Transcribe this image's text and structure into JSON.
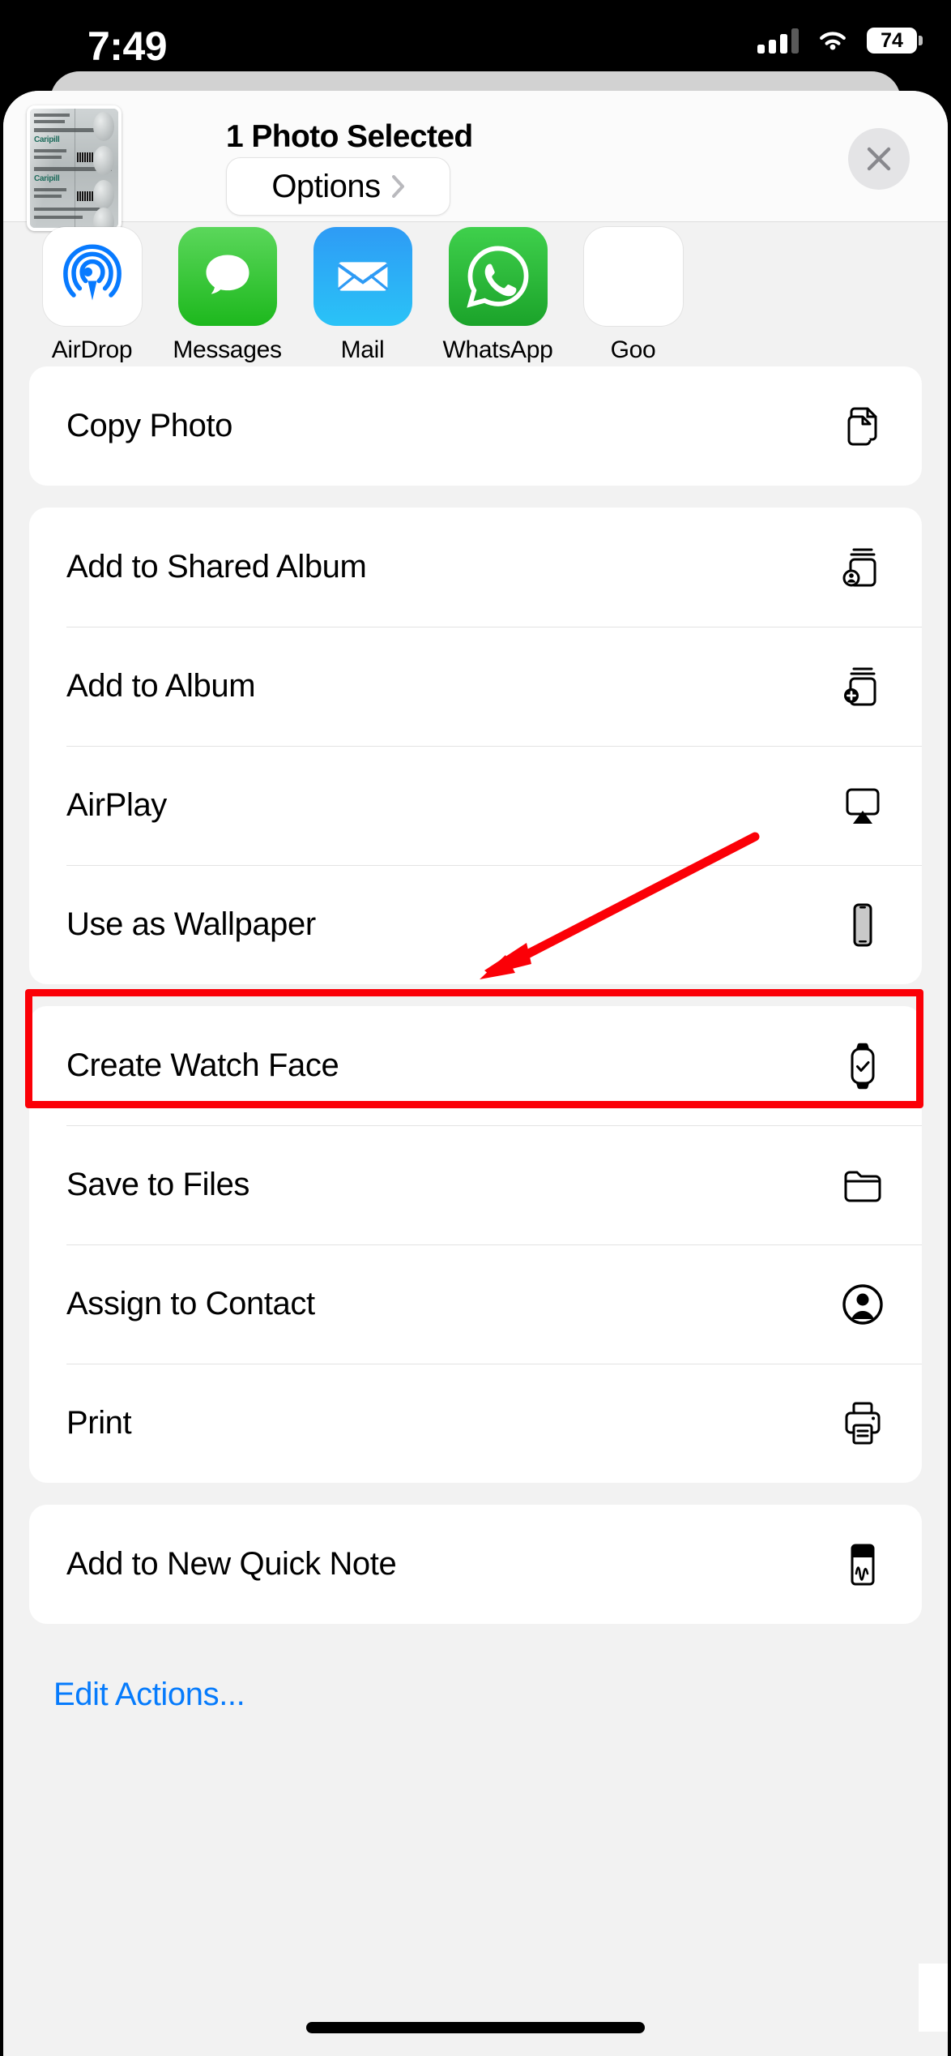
{
  "status_bar": {
    "time": "7:49",
    "battery_percent": "74",
    "cellular_icon": "cellular-bars-icon",
    "wifi_icon": "wifi-icon",
    "battery_icon": "battery-icon"
  },
  "share_sheet": {
    "selection_title": "1 Photo Selected",
    "options_label": "Options",
    "options_chevron_icon": "chevron-right-icon",
    "close_icon": "close-icon",
    "thumbnail": {
      "alt": "Caripill Carica Papaya Leaf Extract Tablets blister pack",
      "brand_text": "Caripill",
      "product_text": "Carica Papaya Leaf Extract Tablets"
    },
    "apps": [
      {
        "name": "AirDrop",
        "icon": "airdrop-icon"
      },
      {
        "name": "Messages",
        "icon": "messages-icon"
      },
      {
        "name": "Mail",
        "icon": "mail-icon"
      },
      {
        "name": "WhatsApp",
        "icon": "whatsapp-icon"
      },
      {
        "name": "Goo",
        "icon": "google-icon"
      }
    ],
    "groups": [
      {
        "rows": [
          {
            "label": "Copy Photo",
            "icon": "doc-on-doc-icon"
          }
        ]
      },
      {
        "rows": [
          {
            "label": "Add to Shared Album",
            "icon": "person-album-icon"
          },
          {
            "label": "Add to Album",
            "icon": "plus-album-icon"
          },
          {
            "label": "AirPlay",
            "icon": "airplay-icon"
          },
          {
            "label": "Use as Wallpaper",
            "icon": "iphone-icon"
          }
        ]
      },
      {
        "rows": [
          {
            "label": "Create Watch Face",
            "icon": "applewatch-icon"
          },
          {
            "label": "Save to Files",
            "icon": "folder-icon"
          },
          {
            "label": "Assign to Contact",
            "icon": "person-circle-icon"
          },
          {
            "label": "Print",
            "icon": "printer-icon",
            "highlighted": true
          }
        ]
      },
      {
        "rows": [
          {
            "label": "Add to New Quick Note",
            "icon": "quicknote-icon"
          }
        ]
      }
    ],
    "edit_actions_label": "Edit Actions..."
  },
  "annotations": {
    "highlight_color": "#FB0007",
    "highlight_target": "Print",
    "arrow_icon": "red-arrow-pointing-to-print"
  },
  "colors": {
    "accent_blue": "#067BFC",
    "sheet_background": "#F2F2F2",
    "card_background": "#FFFFFF",
    "messages_green": "#1DB81D",
    "mail_blue": "#2E9BF5",
    "whatsapp_green": "#1BA32A",
    "airdrop_blue": "#077AFF"
  },
  "home_indicator": "home-indicator"
}
